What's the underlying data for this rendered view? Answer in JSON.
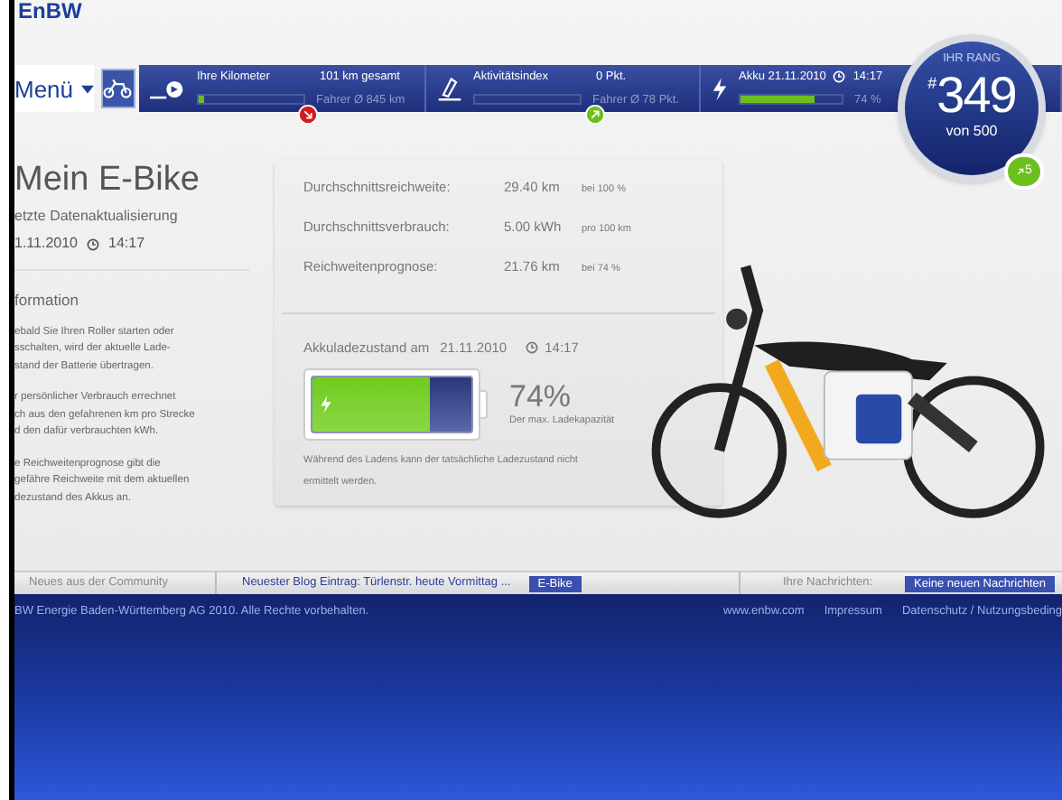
{
  "header": {
    "logo": "EnBW"
  },
  "nav": {
    "menu": "Menü",
    "stats": [
      {
        "kind": "distance",
        "label": "Ihre Kilometer",
        "value": "101 km gesamt",
        "average": "Fahrer Ø 845 km",
        "level": 0.06,
        "rising": false
      },
      {
        "kind": "activity",
        "label": "Aktivitätsindex",
        "value": "0 Pkt.",
        "average": "Fahrer Ø 78 Pkt.",
        "level": 0,
        "rising": true
      },
      {
        "kind": "battery",
        "label": "Akku 21.11.2010",
        "time": "14:17",
        "value": "74 %",
        "level": 0.74
      }
    ]
  },
  "rank": {
    "heading": "IHR RANG",
    "prefix": "#",
    "number": "349",
    "total": "von 500",
    "change": "5"
  },
  "left": {
    "title": "Mein E-Bike",
    "updated_label": "etzte Datenaktualisierung",
    "date": "1.11.2010",
    "time": "14:17",
    "info_heading": "formation",
    "paragraphs": [
      [
        "ebald Sie Ihren Roller starten oder",
        "sschalten, wird der aktuelle Lade-",
        "stand der Batterie übertragen."
      ],
      [
        "r persönlicher Verbrauch errechnet",
        "ch aus den gefahrenen km pro Strecke",
        "d den dafür verbrauchten kWh."
      ],
      [
        "e Reichweitenprognose gibt die",
        "gefähre Reichweite mit dem aktuellen",
        "dezustand des Akkus an."
      ]
    ]
  },
  "stats": [
    {
      "label": "Durchschnittsreichweite:",
      "value": "29.40 km",
      "note": "bei 100 %"
    },
    {
      "label": "Durchschnittsverbrauch:",
      "value": "5.00 kWh",
      "note": "pro 100 km"
    },
    {
      "label": "Reichweitenprognose:",
      "value": "21.76 km",
      "note": "bei 74 %"
    }
  ],
  "charge": {
    "label": "Akkuladezustand am",
    "date": "21.11.2010",
    "time": "14:17",
    "level": 0.74,
    "percent": "74%",
    "caption": "Der max. Ladekapazität",
    "note": "Während des Ladens kann der tatsächliche Ladezustand nicht ermittelt werden."
  },
  "community": {
    "label": "Neues aus der Community",
    "blog": "Neuester Blog Eintrag: Türlenstr. heute Vormittag ...",
    "tag": "E-Bike",
    "messages_label": "Ihre Nachrichten:",
    "messages": "Keine neuen Nachrichten"
  },
  "footer": {
    "copyright": "BW Energie Baden-Württemberg AG 2010. Alle Rechte vorbehalten.",
    "links": [
      "www.enbw.com",
      "Impressum",
      "Datenschutz / Nutzungsbeding"
    ]
  }
}
